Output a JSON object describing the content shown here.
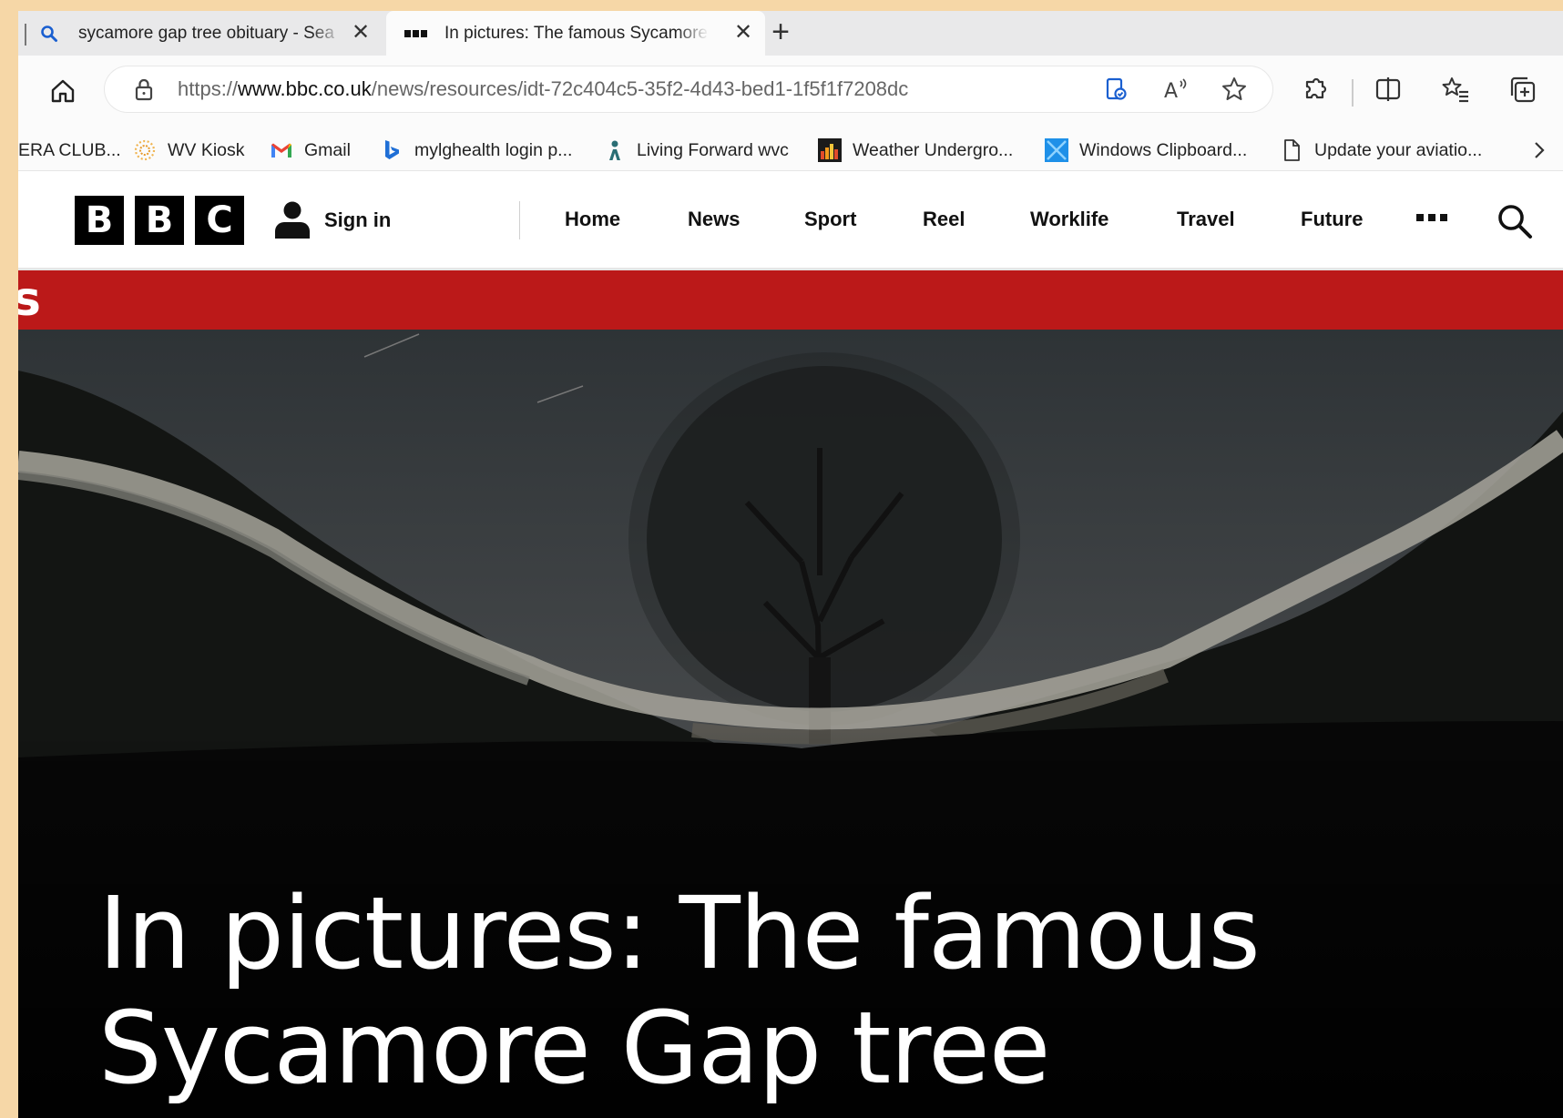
{
  "browser": {
    "tabs": [
      {
        "title": "sycamore gap tree obituary - Sea",
        "icon": "search-icon",
        "active": false
      },
      {
        "title": "In pictures: The famous Sycamore",
        "icon": "bbc-favicon",
        "active": true
      }
    ],
    "address": {
      "scheme": "https://",
      "host": "www.bbc.co.uk",
      "path": "/news/resources/idt-72c404c5-35f2-4d43-bed1-1f5f1f7208dc"
    },
    "favorites": [
      {
        "label": "ERA CLUB...",
        "icon": null
      },
      {
        "label": "WV Kiosk",
        "icon": "sun-icon"
      },
      {
        "label": "Gmail",
        "icon": "gmail-icon"
      },
      {
        "label": "mylghealth login p...",
        "icon": "bing-icon"
      },
      {
        "label": "Living Forward wvc",
        "icon": "living-forward-icon"
      },
      {
        "label": "Weather Undergro...",
        "icon": "wunderground-icon"
      },
      {
        "label": "Windows Clipboard...",
        "icon": "windows-icon"
      },
      {
        "label": "Update your aviatio...",
        "icon": "document-icon"
      }
    ]
  },
  "site": {
    "logo_letters": [
      "B",
      "B",
      "C"
    ],
    "signin_label": "Sign in",
    "nav": [
      "Home",
      "News",
      "Sport",
      "Reel",
      "Worklife",
      "Travel",
      "Future"
    ],
    "section_fragment": "s",
    "section_color": "#bb1919"
  },
  "article": {
    "headline_line1": "In pictures: The famous",
    "headline_line2": "Sycamore Gap tree",
    "hero_image_subject": "Sycamore Gap tree at night beside Hadrian's Wall"
  }
}
